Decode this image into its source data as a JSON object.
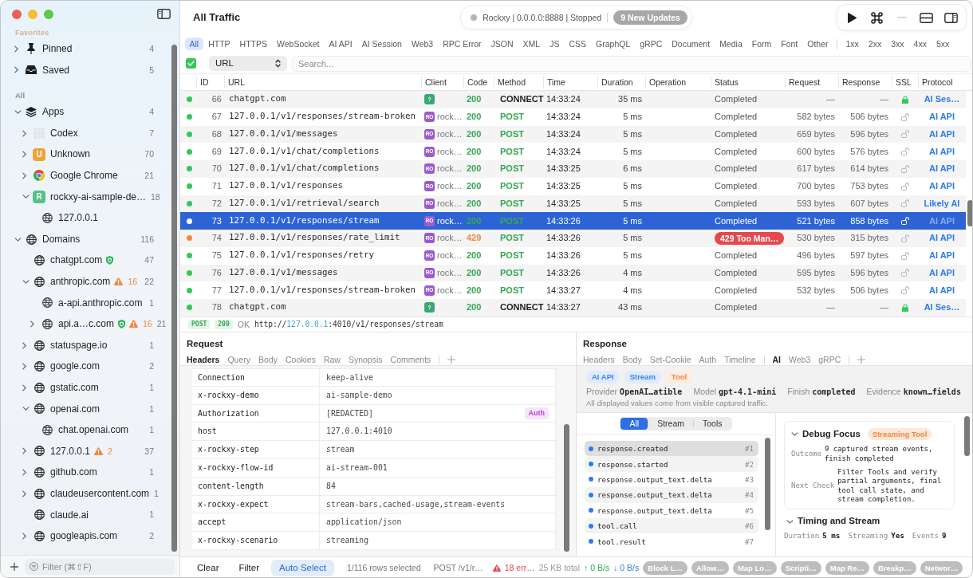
{
  "window": {
    "title": "All Traffic"
  },
  "proxy": {
    "running": false,
    "status": "Rockxy | 0.0.0.0:8888 | Stopped",
    "updates": "9 New Updates"
  },
  "toolbar": [
    {
      "kind": "play",
      "disabled": false
    },
    {
      "kind": "command",
      "disabled": false
    },
    {
      "kind": "minus",
      "disabled": true
    },
    {
      "kind": "split",
      "disabled": false
    },
    {
      "kind": "inspector",
      "disabled": false
    }
  ],
  "sidebar": {
    "sections": [
      {
        "label": "Favorites",
        "items": [
          {
            "kind": "pin",
            "label": "Pinned",
            "count": "4",
            "expanded": false
          },
          {
            "kind": "tray",
            "label": "Saved",
            "count": "5",
            "expanded": false
          }
        ]
      },
      {
        "label": "All",
        "items": [
          {
            "kind": "stack",
            "label": "Apps",
            "count": "4",
            "expanded": true,
            "children": [
              {
                "kind": "blank",
                "label": "Codex",
                "count": "7",
                "expanded": false
              },
              {
                "kind": "letter",
                "letter": "U",
                "color": "#eaa437",
                "label": "Unknown",
                "count": "70",
                "expanded": false
              },
              {
                "kind": "browser",
                "label": "Google Chrome",
                "count": "21",
                "expanded": false
              },
              {
                "kind": "letter",
                "letter": "R",
                "color": "#57bf87",
                "label": "rockxy-ai-sample-de…",
                "count": "18",
                "expanded": true,
                "children": [
                  {
                    "kind": "host",
                    "label": "127.0.0.1"
                  }
                ]
              }
            ]
          },
          {
            "kind": "globe",
            "label": "Domains",
            "count": "116",
            "expanded": true,
            "children": [
              {
                "kind": "globe",
                "label": "chatgpt.com",
                "verified": true,
                "count": "47"
              },
              {
                "kind": "globe",
                "label": "anthropic.com",
                "verified": false,
                "warnings": "16",
                "count": "22",
                "expanded": true,
                "children": [
                  {
                    "kind": "host",
                    "label": "a-api.anthropic.com",
                    "verified": false,
                    "count": "1"
                  },
                  {
                    "kind": "host",
                    "label": "api.a…c.com",
                    "verified": true,
                    "warnings": "16",
                    "count": "21",
                    "expanded": false
                  }
                ]
              },
              {
                "kind": "globe",
                "label": "statuspage.io",
                "verified": false,
                "count": "1",
                "expanded": false
              },
              {
                "kind": "globe",
                "label": "google.com",
                "verified": false,
                "count": "2",
                "expanded": false
              },
              {
                "kind": "globe",
                "label": "gstatic.com",
                "verified": false,
                "count": "1",
                "expanded": false
              },
              {
                "kind": "globe",
                "label": "openai.com",
                "verified": false,
                "count": "1",
                "expanded": true,
                "children": [
                  {
                    "kind": "host",
                    "label": "chat.openai.com",
                    "verified": false,
                    "count": "1"
                  }
                ]
              },
              {
                "kind": "globe",
                "label": "127.0.0.1",
                "verified": false,
                "warnings": "2",
                "count": "37",
                "expanded": false
              },
              {
                "kind": "globe",
                "label": "github.com",
                "verified": false,
                "count": "1",
                "expanded": false
              },
              {
                "kind": "globe",
                "label": "claudeusercontent.com",
                "verified": false,
                "count": "1",
                "expanded": false
              },
              {
                "kind": "globe",
                "label": "claude.ai",
                "verified": false,
                "count": "1"
              },
              {
                "kind": "globe",
                "label": "googleapis.com",
                "verified": false,
                "count": "2",
                "expanded": false
              }
            ]
          }
        ]
      }
    ],
    "filter_placeholder": "Filter (⌘⇧F)"
  },
  "filters": {
    "types": [
      {
        "label": "All",
        "selected": true
      },
      {
        "label": "HTTP",
        "selected": false
      },
      {
        "label": "HTTPS",
        "selected": false
      },
      {
        "label": "WebSocket",
        "selected": false
      },
      {
        "label": "AI API",
        "selected": false
      },
      {
        "label": "AI Session",
        "selected": false
      },
      {
        "label": "Web3",
        "selected": false
      },
      {
        "label": "RPC Error",
        "selected": false
      },
      {
        "label": "JSON",
        "selected": false
      },
      {
        "label": "XML",
        "selected": false
      },
      {
        "label": "JS",
        "selected": false
      },
      {
        "label": "CSS",
        "selected": false
      },
      {
        "label": "GraphQL",
        "selected": false
      },
      {
        "label": "gRPC",
        "selected": false
      },
      {
        "label": "Document",
        "selected": false
      },
      {
        "label": "Media",
        "selected": false
      },
      {
        "label": "Form",
        "selected": false
      },
      {
        "label": "Font",
        "selected": false
      },
      {
        "label": "Other",
        "selected": false
      }
    ],
    "statuses": [
      {
        "label": "1xx",
        "selected": false
      },
      {
        "label": "2xx",
        "selected": false
      },
      {
        "label": "3xx",
        "selected": false
      },
      {
        "label": "4xx",
        "selected": false
      },
      {
        "label": "5xx",
        "selected": false
      }
    ]
  },
  "search": {
    "checked": true,
    "field": "URL",
    "placeholder": "Search..."
  },
  "table": {
    "columns": [
      "ID",
      "URL",
      "Client",
      "Code",
      "Method",
      "Time",
      "Duration",
      "Operation",
      "Status",
      "Request",
      "Response",
      "SSL",
      "Protocol"
    ],
    "rows": [
      {
        "kind": "tunnel",
        "color": "#34c759",
        "id": "66",
        "url": "chatgpt.com",
        "client_badge": "?",
        "code": "200",
        "method": "CONNECT",
        "time": "14:33:24",
        "duration": "35 ms",
        "status": "Completed",
        "request": "—",
        "response": "—",
        "encrypted": true,
        "protocol": "AI Ses…",
        "failed": false,
        "selected": false
      },
      {
        "kind": "request",
        "color": "#34c759",
        "id": "67",
        "url": "127.0.0.1/v1/responses/stream-broken",
        "client_badge": "RO",
        "client": "rock…",
        "code": "200",
        "method": "POST",
        "time": "14:33:24",
        "duration": "5 ms",
        "status": "Completed",
        "request": "582 bytes",
        "response": "506 bytes",
        "encrypted": false,
        "protocol": "AI API",
        "failed": false,
        "selected": false
      },
      {
        "kind": "request",
        "color": "#34c759",
        "id": "68",
        "url": "127.0.0.1/v1/messages",
        "client_badge": "RO",
        "client": "rock…",
        "code": "200",
        "method": "POST",
        "time": "14:33:24",
        "duration": "5 ms",
        "status": "Completed",
        "request": "659 bytes",
        "response": "596 bytes",
        "encrypted": false,
        "protocol": "AI API",
        "failed": false,
        "selected": false
      },
      {
        "kind": "request",
        "color": "#34c759",
        "id": "69",
        "url": "127.0.0.1/v1/chat/completions",
        "client_badge": "RO",
        "client": "rock…",
        "code": "200",
        "method": "POST",
        "time": "14:33:24",
        "duration": "5 ms",
        "status": "Completed",
        "request": "600 bytes",
        "response": "576 bytes",
        "encrypted": false,
        "protocol": "AI API",
        "failed": false,
        "selected": false
      },
      {
        "kind": "request",
        "color": "#34c759",
        "id": "70",
        "url": "127.0.0.1/v1/chat/completions",
        "client_badge": "RO",
        "client": "rock…",
        "code": "200",
        "method": "POST",
        "time": "14:33:25",
        "duration": "6 ms",
        "status": "Completed",
        "request": "617 bytes",
        "response": "614 bytes",
        "encrypted": false,
        "protocol": "AI API",
        "failed": false,
        "selected": false
      },
      {
        "kind": "request",
        "color": "#34c759",
        "id": "71",
        "url": "127.0.0.1/v1/responses",
        "client_badge": "RO",
        "client": "rock…",
        "code": "200",
        "method": "POST",
        "time": "14:33:25",
        "duration": "5 ms",
        "status": "Completed",
        "request": "700 bytes",
        "response": "753 bytes",
        "encrypted": false,
        "protocol": "AI API",
        "failed": false,
        "selected": false
      },
      {
        "kind": "request",
        "color": "#34c759",
        "id": "72",
        "url": "127.0.0.1/v1/retrieval/search",
        "client_badge": "RO",
        "client": "rock…",
        "code": "200",
        "method": "POST",
        "time": "14:33:25",
        "duration": "5 ms",
        "status": "Completed",
        "request": "593 bytes",
        "response": "607 bytes",
        "encrypted": false,
        "protocol": "Likely AI",
        "failed": false,
        "selected": false
      },
      {
        "kind": "request",
        "color": "#ffffff",
        "id": "73",
        "url": "127.0.0.1/v1/responses/stream",
        "client_badge": "RO",
        "client": "rock…",
        "code": "200",
        "method": "POST",
        "time": "14:33:26",
        "duration": "5 ms",
        "status": "Completed",
        "request": "521 bytes",
        "response": "858 bytes",
        "encrypted": false,
        "protocol": "AI API",
        "failed": false,
        "selected": true
      },
      {
        "kind": "request",
        "color": "#f0883e",
        "id": "74",
        "url": "127.0.0.1/v1/responses/rate_limit",
        "client_badge": "RO",
        "client": "rock…",
        "code": "429",
        "method": "POST",
        "time": "14:33:26",
        "duration": "5 ms",
        "status": "429 Too Man…",
        "request": "530 bytes",
        "response": "315 bytes",
        "encrypted": false,
        "protocol": "AI API",
        "failed": true,
        "selected": false
      },
      {
        "kind": "request",
        "color": "#34c759",
        "id": "75",
        "url": "127.0.0.1/v1/responses/retry",
        "client_badge": "RO",
        "client": "rock…",
        "code": "200",
        "method": "POST",
        "time": "14:33:26",
        "duration": "5 ms",
        "status": "Completed",
        "request": "496 bytes",
        "response": "597 bytes",
        "encrypted": false,
        "protocol": "AI API",
        "failed": false,
        "selected": false
      },
      {
        "kind": "request",
        "color": "#34c759",
        "id": "76",
        "url": "127.0.0.1/v1/messages",
        "client_badge": "RO",
        "client": "rock…",
        "code": "200",
        "method": "POST",
        "time": "14:33:26",
        "duration": "4 ms",
        "status": "Completed",
        "request": "595 bytes",
        "response": "596 bytes",
        "encrypted": false,
        "protocol": "AI API",
        "failed": false,
        "selected": false
      },
      {
        "kind": "request",
        "color": "#34c759",
        "id": "77",
        "url": "127.0.0.1/v1/responses/stream-broken",
        "client_badge": "RO",
        "client": "rock…",
        "code": "200",
        "method": "POST",
        "time": "14:33:27",
        "duration": "4 ms",
        "status": "Completed",
        "request": "532 bytes",
        "response": "506 bytes",
        "encrypted": false,
        "protocol": "AI API",
        "failed": false,
        "selected": false
      },
      {
        "kind": "tunnel",
        "color": "#34c759",
        "id": "78",
        "url": "chatgpt.com",
        "client_badge": "?",
        "code": "200",
        "method": "CONNECT",
        "time": "14:33:27",
        "duration": "43 ms",
        "status": "Completed",
        "request": "—",
        "response": "—",
        "encrypted": true,
        "protocol": "AI Ses…",
        "failed": false,
        "selected": false
      }
    ]
  },
  "detail": {
    "method": "POST",
    "code": "200",
    "reason": "OK",
    "url": {
      "scheme": "http://",
      "host": "127.0.0.1",
      "rest": ":4010/v1/responses/stream"
    }
  },
  "request": {
    "title": "Request",
    "tab_groups": [
      [
        {
          "label": "Headers",
          "selected": true
        },
        {
          "label": "Query",
          "selected": false
        },
        {
          "label": "Body",
          "selected": false
        },
        {
          "label": "Cookies",
          "selected": false
        },
        {
          "label": "Raw",
          "selected": false
        },
        {
          "label": "Synopsis",
          "selected": false
        },
        {
          "label": "Comments",
          "selected": false
        }
      ]
    ],
    "headers": [
      {
        "name": "Connection",
        "value": "keep-alive"
      },
      {
        "name": "x-rockxy-demo",
        "value": "ai-sample-demo"
      },
      {
        "name": "Authorization",
        "value": "[REDACTED]",
        "tag": "Auth"
      },
      {
        "name": "host",
        "value": "127.0.0.1:4010"
      },
      {
        "name": "x-rockxy-step",
        "value": "stream"
      },
      {
        "name": "x-rockxy-flow-id",
        "value": "ai-stream-001"
      },
      {
        "name": "content-length",
        "value": "84"
      },
      {
        "name": "x-rockxy-expect",
        "value": "stream-bars,cached-usage,stream-events"
      },
      {
        "name": "accept",
        "value": "application/json"
      },
      {
        "name": "x-rockxy-scenario",
        "value": "streaming"
      }
    ]
  },
  "response": {
    "title": "Response",
    "tab_groups": [
      [
        {
          "label": "Headers",
          "selected": false
        },
        {
          "label": "Body",
          "selected": false
        },
        {
          "label": "Set-Cookie",
          "selected": false
        },
        {
          "label": "Auth",
          "selected": false
        },
        {
          "label": "Timeline",
          "selected": false
        }
      ],
      [
        {
          "label": "AI",
          "selected": true
        },
        {
          "label": "Web3",
          "selected": false
        },
        {
          "label": "gRPC",
          "selected": false
        }
      ]
    ],
    "tags": [
      {
        "label": "AI API",
        "color": "#3b82f6"
      },
      {
        "label": "Stream",
        "color": "#3b82f6"
      },
      {
        "label": "Tool",
        "color": "#f0883e"
      }
    ],
    "fields": [
      {
        "label": "Provider",
        "value": "OpenAI…atible"
      },
      {
        "label": "Model",
        "value": "gpt-4.1-mini"
      },
      {
        "label": "Finish",
        "value": "completed"
      },
      {
        "label": "Evidence",
        "value": "known…fields"
      }
    ],
    "note": "All displayed values come from visible captured traffic.",
    "segments": [
      {
        "label": "All",
        "selected": true
      },
      {
        "label": "Stream",
        "selected": false
      },
      {
        "label": "Tools",
        "selected": false
      }
    ],
    "events": [
      {
        "name": "response.created",
        "number": "#1",
        "selected": true
      },
      {
        "name": "response.started",
        "number": "#2",
        "selected": false
      },
      {
        "name": "response.output_text.delta",
        "number": "#3",
        "selected": false
      },
      {
        "name": "response.output_text.delta",
        "number": "#4",
        "selected": false
      },
      {
        "name": "response.output_text.delta",
        "number": "#5",
        "selected": false
      },
      {
        "name": "tool.call",
        "number": "#6",
        "selected": false
      },
      {
        "name": "tool.result",
        "number": "#7",
        "selected": false
      }
    ],
    "debug_focus": {
      "title": "Debug Focus",
      "tag": "Streaming Tool",
      "expanded": true,
      "rows": [
        {
          "label": "Outcome",
          "value": "9 captured stream events, finish completed"
        },
        {
          "label": "Next Check",
          "value": "Filter Tools and verify partial arguments, final tool call state, and stream completion."
        }
      ]
    },
    "timing": {
      "title": "Timing and Stream",
      "expanded": true,
      "fields": [
        {
          "label": "Duration",
          "value": "5 ms"
        },
        {
          "label": "Streaming",
          "value": "Yes"
        },
        {
          "label": "Events",
          "value": "9"
        }
      ]
    }
  },
  "bottom_bar": {
    "buttons": [
      {
        "label": "Clear",
        "selected": false
      },
      {
        "label": "Filter",
        "selected": false
      },
      {
        "label": "Auto Select",
        "selected": true
      }
    ],
    "selection": "1/116 rows selected",
    "current": "POST /v1/r…",
    "errors": "18 err…",
    "total": "25 KB total",
    "upload": "↑ 0 B/s",
    "download": "↓ 0 B/s",
    "tools": [
      "Block L…",
      "Allow…",
      "Map Lo…",
      "Scripti…",
      "Map Re…",
      "Breakp…",
      "Networ…"
    ]
  }
}
